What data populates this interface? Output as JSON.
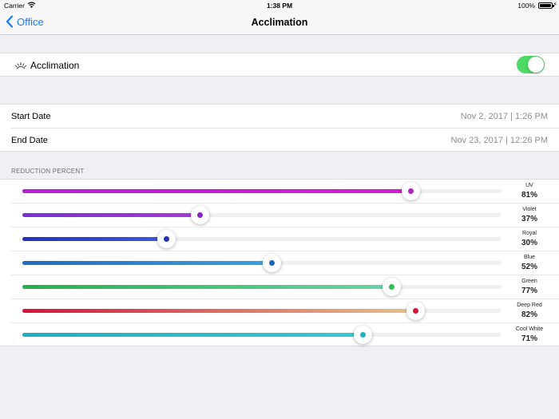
{
  "status_bar": {
    "carrier": "Carrier",
    "time": "1:38 PM",
    "battery": "100%"
  },
  "nav": {
    "back_label": "Office",
    "title": "Acclimation"
  },
  "acclimation": {
    "label": "Acclimation",
    "enabled": true,
    "toggle_color": "#4cd964"
  },
  "dates": {
    "start_label": "Start Date",
    "start_value": "Nov 2, 2017 | 1:26 PM",
    "end_label": "End Date",
    "end_value": "Nov 23, 2017 | 12:26 PM"
  },
  "reduction": {
    "header": "REDUCTION PERCENT",
    "channels": [
      {
        "name": "UV",
        "percent": "81%",
        "value": 81,
        "color_start": "#b51fd6",
        "color_end": "#d21fc9",
        "dot": "#b81ec4"
      },
      {
        "name": "Violet",
        "percent": "37%",
        "value": 37,
        "color_start": "#7b2fd1",
        "color_end": "#a83bd8",
        "dot": "#8a22c8"
      },
      {
        "name": "Royal",
        "percent": "30%",
        "value": 30,
        "color_start": "#2233b8",
        "color_end": "#3d5ad8",
        "dot": "#2233b8"
      },
      {
        "name": "Blue",
        "percent": "52%",
        "value": 52,
        "color_start": "#1f6cc4",
        "color_end": "#3aa3dd",
        "dot": "#1c63c0"
      },
      {
        "name": "Green",
        "percent": "77%",
        "value": 77,
        "color_start": "#23b24a",
        "color_end": "#6bd4a8",
        "dot": "#2fbf5a"
      },
      {
        "name": "Deep Red",
        "percent": "82%",
        "value": 82,
        "color_start": "#d6143c",
        "color_end": "#e6c28a",
        "dot": "#d0143c"
      },
      {
        "name": "Cool White",
        "percent": "71%",
        "value": 71,
        "color_start": "#1fb0c0",
        "color_end": "#3cc6cf",
        "dot": "#22b2c2"
      }
    ]
  },
  "icons": {
    "back": "chevron-left-icon",
    "wifi": "wifi-icon",
    "battery": "battery-icon",
    "charging": "bolt-icon",
    "acclimation": "sun-rays-icon"
  },
  "accent_color": "#1a7cf5"
}
